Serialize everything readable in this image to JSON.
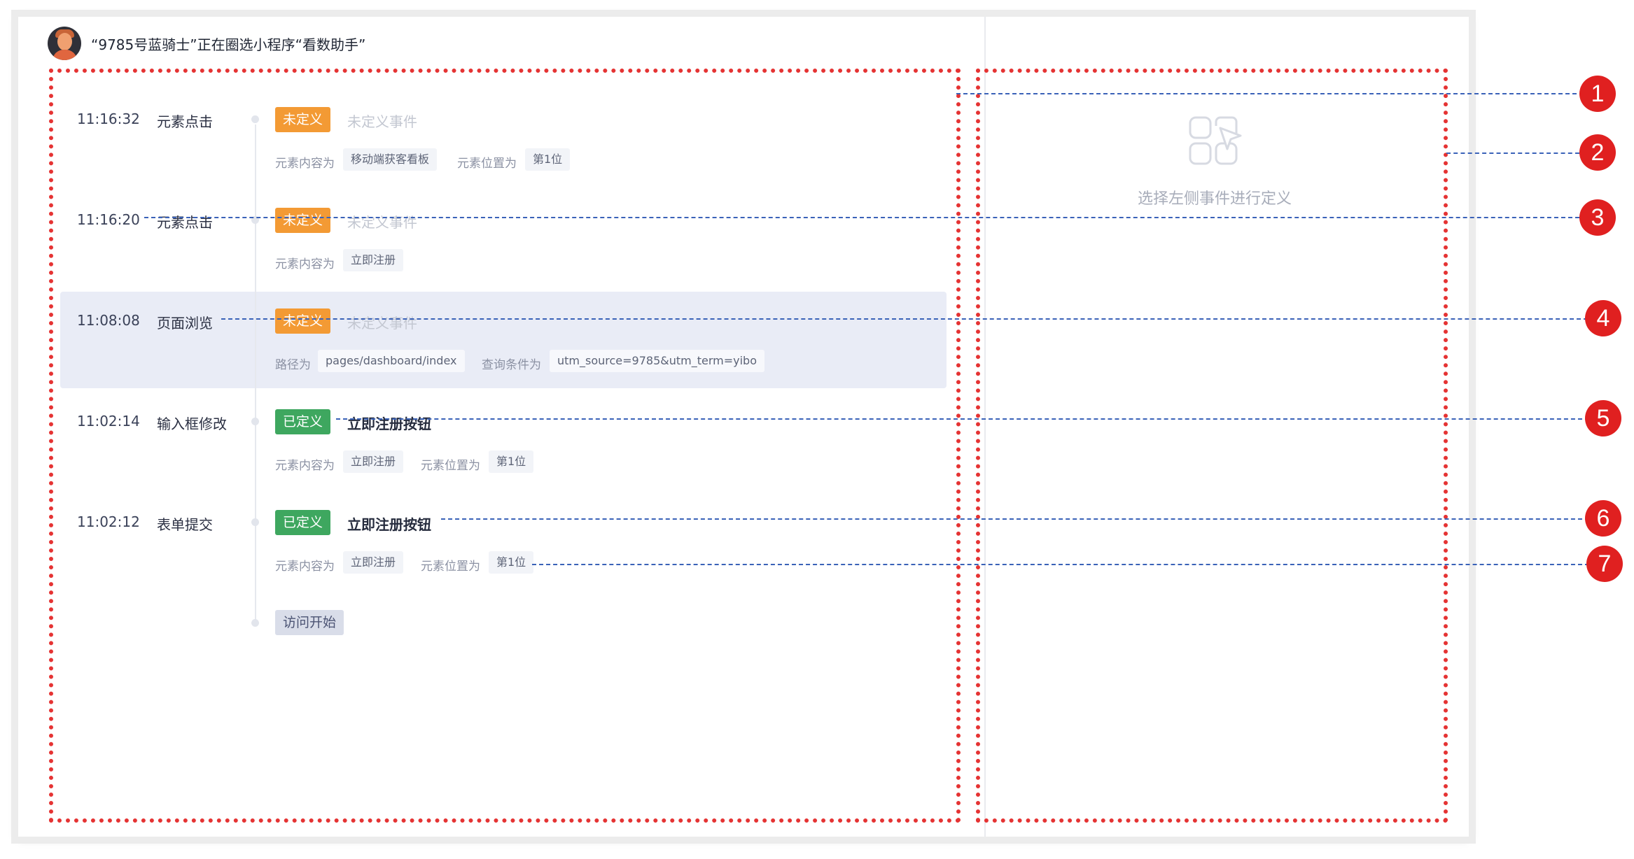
{
  "header": {
    "title": "“9785号蓝骑士”正在圈选小程序“看数助手”"
  },
  "events": [
    {
      "time": "11:16:32",
      "type": "元素点击",
      "tag": "未定义",
      "name": "未定义事件",
      "meta": [
        {
          "label": "元素内容为",
          "value": "移动端获客看板"
        },
        {
          "label": "元素位置为",
          "value": "第1位"
        }
      ]
    },
    {
      "time": "11:16:20",
      "type": "元素点击",
      "tag": "未定义",
      "name": "未定义事件",
      "meta": [
        {
          "label": "元素内容为",
          "value": "立即注册"
        }
      ]
    },
    {
      "time": "11:08:08",
      "type": "页面浏览",
      "tag": "未定义",
      "name": "未定义事件",
      "meta": [
        {
          "label": "路径为",
          "value": "pages/dashboard/index"
        },
        {
          "label": "查询条件为",
          "value": "utm_source=9785&utm_term=yibo"
        }
      ]
    },
    {
      "time": "11:02:14",
      "type": "输入框修改",
      "tag": "已定义",
      "name": "立即注册按钮",
      "meta": [
        {
          "label": "元素内容为",
          "value": "立即注册"
        },
        {
          "label": "元素位置为",
          "value": "第1位"
        }
      ]
    },
    {
      "time": "11:02:12",
      "type": "表单提交",
      "tag": "已定义",
      "name": "立即注册按钮",
      "meta": [
        {
          "label": "元素内容为",
          "value": "立即注册"
        },
        {
          "label": "元素位置为",
          "value": "第1位"
        }
      ]
    }
  ],
  "visit_start": "访问开始",
  "right_panel": {
    "empty_text": "选择左侧事件进行定义",
    "icon": "grid-pointer-icon"
  },
  "annotations": [
    "1",
    "2",
    "3",
    "4",
    "5",
    "6",
    "7"
  ],
  "colors": {
    "undefined_tag": "#f39a34",
    "defined_tag": "#3ea75f",
    "highlight_row": "#e9ecf6",
    "annotation_red": "#e02020",
    "leader_blue": "#3a62b8"
  }
}
